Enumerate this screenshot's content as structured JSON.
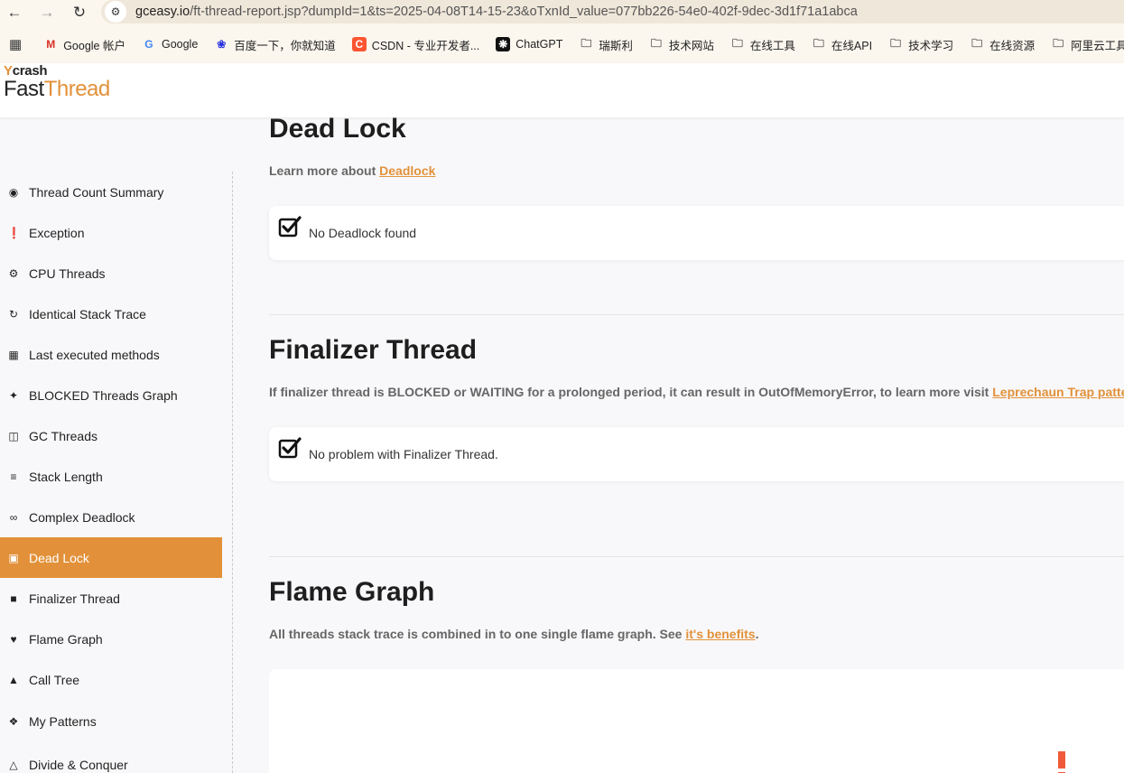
{
  "browser": {
    "url_host": "gceasy.io",
    "url_path": "/ft-thread-report.jsp?dumpId=1&ts=2025-04-08T14-15-23&oTxnId_value=077bb226-54e0-402f-9dec-3d1f71a1abca",
    "bookmarks": [
      {
        "label": "Google 帐户",
        "icon": "gmail-icon"
      },
      {
        "label": "Google",
        "icon": "google-icon"
      },
      {
        "label": "百度一下，你就知道",
        "icon": "baidu-icon"
      },
      {
        "label": "CSDN - 专业开发者...",
        "icon": "csdn-icon"
      },
      {
        "label": "ChatGPT",
        "icon": "chatgpt-icon"
      },
      {
        "label": "瑞斯利",
        "icon": "folder-icon"
      },
      {
        "label": "技术网站",
        "icon": "folder-icon"
      },
      {
        "label": "在线工具",
        "icon": "folder-icon"
      },
      {
        "label": "在线API",
        "icon": "folder-icon"
      },
      {
        "label": "技术学习",
        "icon": "folder-icon"
      },
      {
        "label": "在线资源",
        "icon": "folder-icon"
      },
      {
        "label": "阿里云工具",
        "icon": "folder-icon"
      }
    ]
  },
  "logo": {
    "top": "crash",
    "fast": "Fast",
    "thread": "Thread"
  },
  "sidebar": {
    "items": [
      {
        "label": "Thread Count Summary",
        "icon": "dashboard-icon"
      },
      {
        "label": "Exception",
        "icon": "exclamation-icon"
      },
      {
        "label": "CPU Threads",
        "icon": "cogs-icon"
      },
      {
        "label": "Identical Stack Trace",
        "icon": "redo-icon"
      },
      {
        "label": "Last executed methods",
        "icon": "cubes-icon"
      },
      {
        "label": "BLOCKED Threads Graph",
        "icon": "crosshair-icon"
      },
      {
        "label": "GC Threads",
        "icon": "trash-icon"
      },
      {
        "label": "Stack Length",
        "icon": "stack-icon"
      },
      {
        "label": "Complex Deadlock",
        "icon": "link-icon"
      },
      {
        "label": "Dead Lock",
        "icon": "lock-icon"
      },
      {
        "label": "Finalizer Thread",
        "icon": "square-icon"
      },
      {
        "label": "Flame Graph",
        "icon": "fire-icon"
      },
      {
        "label": "Call Tree",
        "icon": "tree-icon"
      },
      {
        "label": "My Patterns",
        "icon": "puzzle-icon"
      },
      {
        "label": "Divide & Conquer",
        "icon": "sitemap-icon"
      }
    ],
    "active_index": 9
  },
  "deadlock": {
    "title": "Dead Lock",
    "desc_prefix": "Learn more about ",
    "desc_link": "Deadlock",
    "result": "No Deadlock found"
  },
  "finalizer": {
    "title": "Finalizer Thread",
    "desc_prefix": "If finalizer thread is BLOCKED or WAITING for a prolonged period, it can result in OutOfMemoryError, to learn more visit ",
    "desc_link": "Leprechaun Trap patte",
    "result": "No problem with Finalizer Thread."
  },
  "flame": {
    "title": "Flame Graph",
    "desc_prefix": "All threads stack trace is combined in to one single flame graph. See ",
    "desc_link": "it's benefits",
    "desc_suffix": "."
  },
  "colors": {
    "accent": "#e2913a",
    "flame_mark": "#f05a3a"
  }
}
